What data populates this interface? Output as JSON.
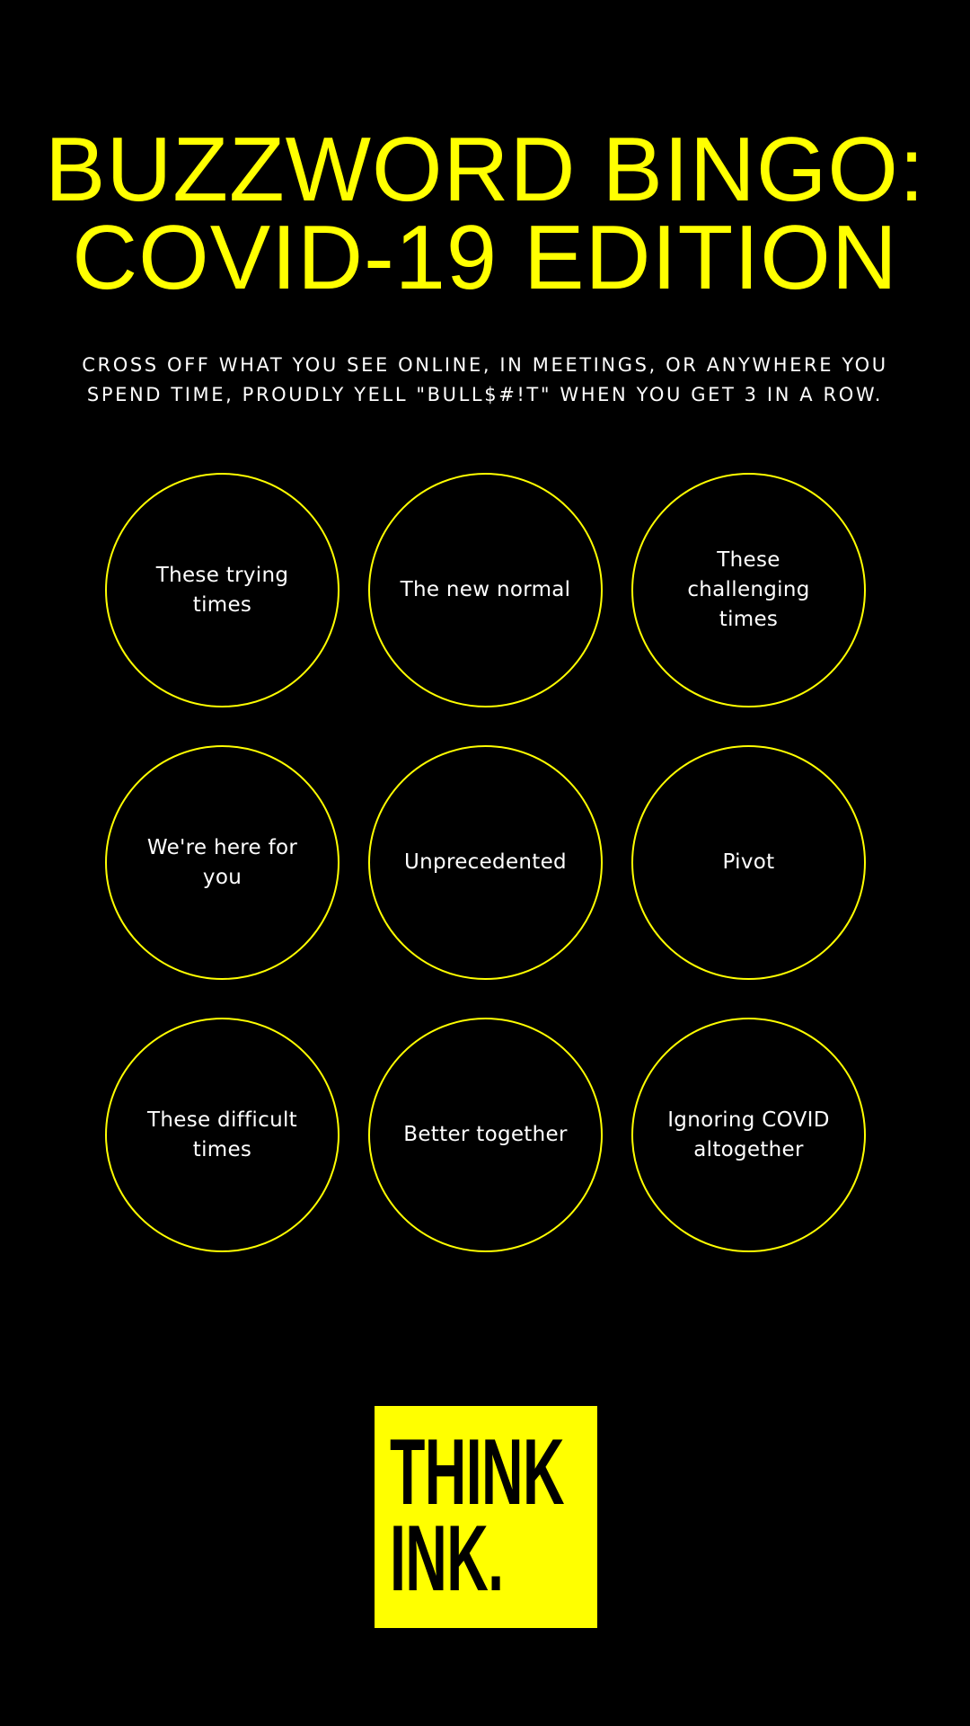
{
  "title": {
    "line1": "BUZZWORD BINGO:",
    "line2": "COVID-19 EDITION"
  },
  "subtitle": {
    "line1": "CROSS OFF WHAT YOU SEE ONLINE, IN MEETINGS, OR ANYWHERE YOU",
    "line2": "SPEND TIME, PROUDLY YELL \"BULL$#!T\" WHEN YOU GET 3 IN A ROW."
  },
  "bingo": {
    "cells": [
      {
        "label": "These trying times"
      },
      {
        "label": "The new normal"
      },
      {
        "label": "These challenging times"
      },
      {
        "label": "We're here for you"
      },
      {
        "label": "Unprecedented"
      },
      {
        "label": "Pivot"
      },
      {
        "label": "These difficult times"
      },
      {
        "label": "Better together"
      },
      {
        "label": "Ignoring COVID altogether"
      }
    ]
  },
  "logo": {
    "line1": "THINK",
    "line2": "INK."
  },
  "colors": {
    "background": "#000000",
    "accent": "#ffff00",
    "text": "#ffffff"
  }
}
